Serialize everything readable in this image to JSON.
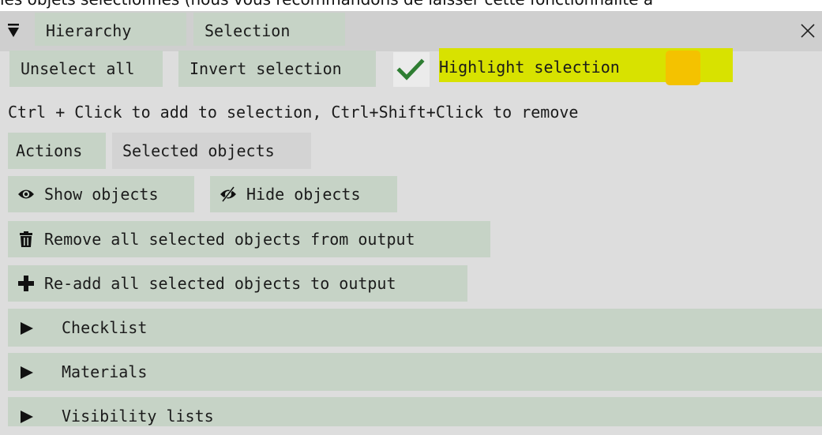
{
  "top_banner": {
    "text": "les objets sélectionnés (nous vous recommandons de laisser cette fonctionnalité a"
  },
  "window": {
    "tabs": [
      {
        "label": "Hierarchy"
      },
      {
        "label": "Selection"
      }
    ],
    "collapse_icon": "triangle-down-icon",
    "close_icon": "close-icon"
  },
  "toolbar": {
    "unselect_all": "Unselect all",
    "invert_selection": "Invert selection",
    "highlight_selection": {
      "label": "Highlight selection",
      "checked": true,
      "color": "#f4c200"
    }
  },
  "hint": "Ctrl + Click to add to selection, Ctrl+Shift+Click to remove",
  "subtabs": [
    {
      "label": "Actions",
      "active": true
    },
    {
      "label": "Selected objects",
      "active": false
    }
  ],
  "actions": {
    "show_objects": {
      "label": "Show objects",
      "icon": "eye-icon"
    },
    "hide_objects": {
      "label": "Hide objects",
      "icon": "eye-slash-icon"
    },
    "remove_all": {
      "label": "Remove all selected objects from output",
      "icon": "trash-icon"
    },
    "readd_all": {
      "label": "Re-add all selected objects to output",
      "icon": "plus-icon"
    }
  },
  "sections": [
    {
      "label": "Checklist"
    },
    {
      "label": "Materials"
    },
    {
      "label": "Visibility lists"
    }
  ],
  "colors": {
    "accent_button": "#c6d3c6",
    "highlight": "#d8e200",
    "swatch": "#f4c200",
    "check": "#2e7d32"
  }
}
